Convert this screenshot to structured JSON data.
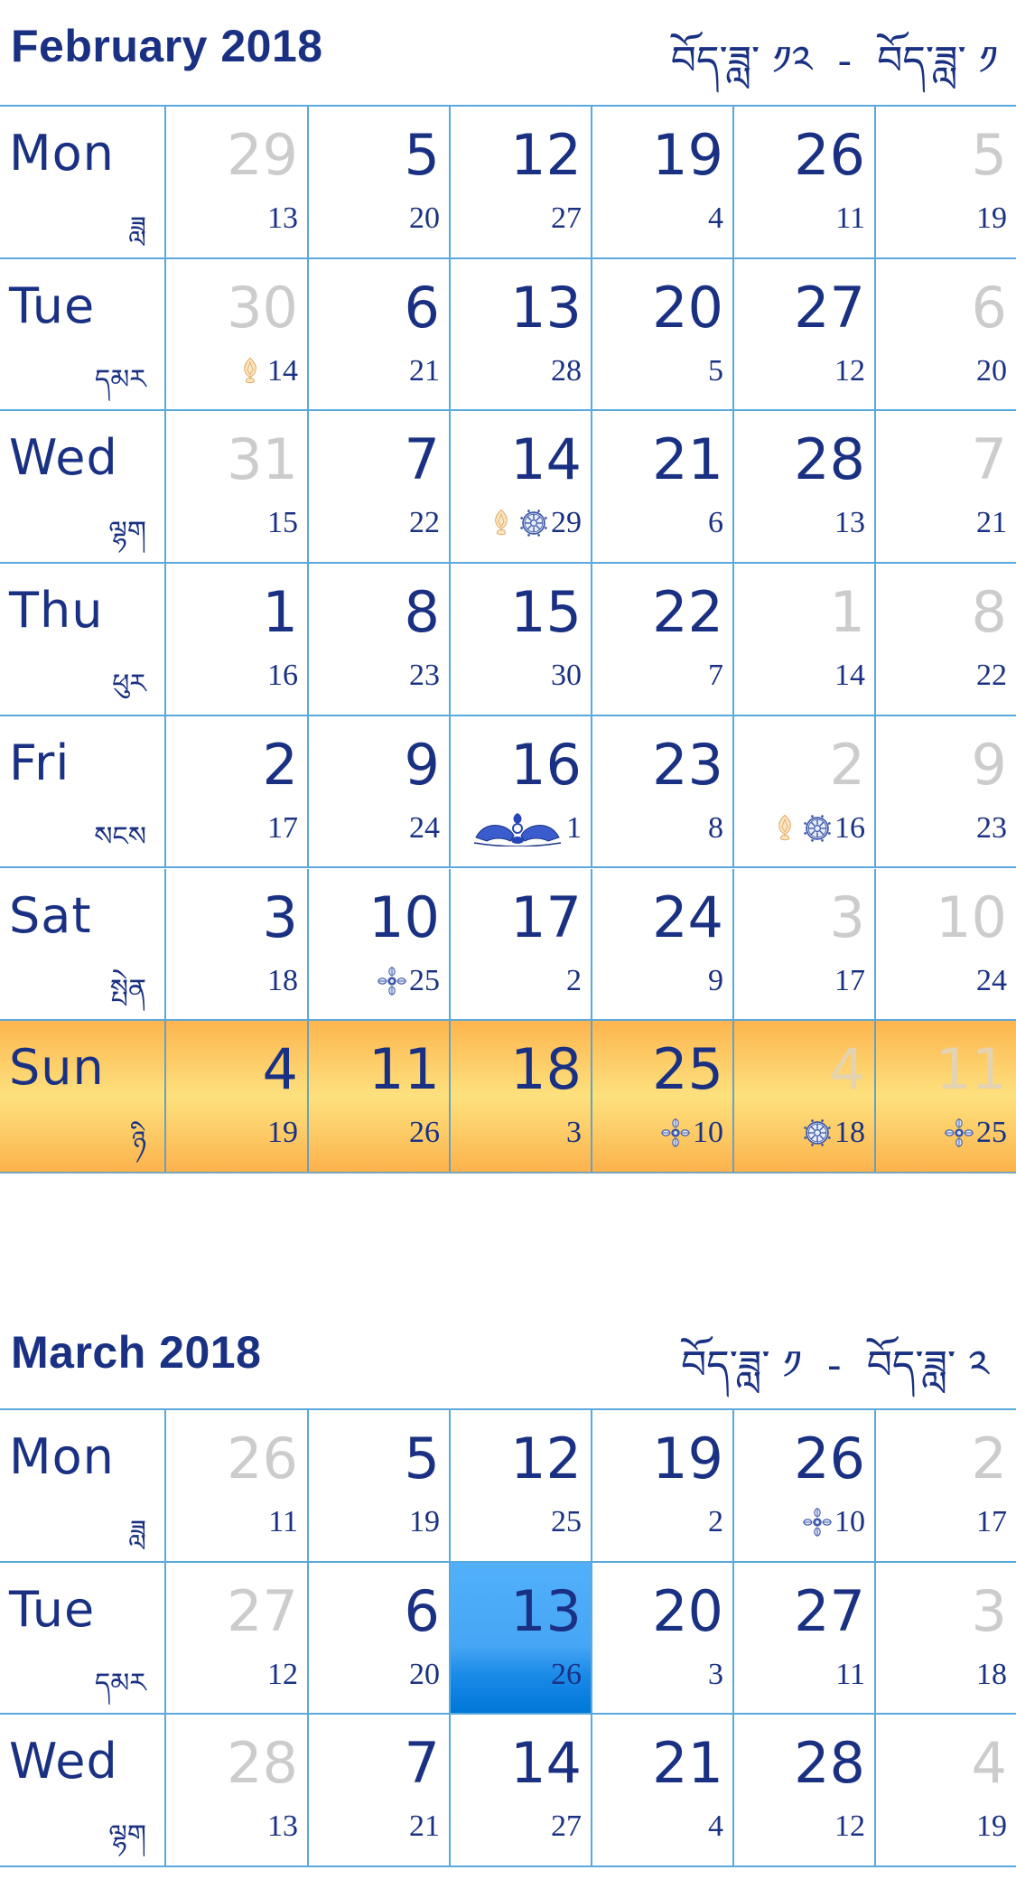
{
  "colors": {
    "primary_text": "#1a3183",
    "other_month_text": "#cccccc",
    "grid_line": "#5aa8dc",
    "sunday_highlight": "#fdd470",
    "today_highlight": "#46a6f5"
  },
  "weekdays": [
    {
      "en": "Mon",
      "tib": "ཟླ"
    },
    {
      "en": "Tue",
      "tib": "དམར"
    },
    {
      "en": "Wed",
      "tib": "ལྷག"
    },
    {
      "en": "Thu",
      "tib": "ཕུར"
    },
    {
      "en": "Fri",
      "tib": "སངས"
    },
    {
      "en": "Sat",
      "tib": "སྤེན"
    },
    {
      "en": "Sun",
      "tib": "ཉི"
    }
  ],
  "months": [
    {
      "title": "February 2018",
      "tibetan_range": "བོད་ཟླ་ ༡༢  -  བོད་ཟླ་ ༡",
      "highlight_row": 6,
      "rows": [
        [
          {
            "day": "29",
            "lunar": "13",
            "other": true
          },
          {
            "day": "5",
            "lunar": "20"
          },
          {
            "day": "12",
            "lunar": "27"
          },
          {
            "day": "19",
            "lunar": "4"
          },
          {
            "day": "26",
            "lunar": "11"
          },
          {
            "day": "5",
            "lunar": "19",
            "other": true
          }
        ],
        [
          {
            "day": "30",
            "lunar": "14",
            "other": true,
            "icons": [
              "flame-jewel"
            ]
          },
          {
            "day": "6",
            "lunar": "21"
          },
          {
            "day": "13",
            "lunar": "28"
          },
          {
            "day": "20",
            "lunar": "5"
          },
          {
            "day": "27",
            "lunar": "12"
          },
          {
            "day": "6",
            "lunar": "20",
            "other": true
          }
        ],
        [
          {
            "day": "31",
            "lunar": "15",
            "other": true
          },
          {
            "day": "7",
            "lunar": "22"
          },
          {
            "day": "14",
            "lunar": "29",
            "icons": [
              "flame-jewel",
              "dharma-wheel"
            ]
          },
          {
            "day": "21",
            "lunar": "6"
          },
          {
            "day": "28",
            "lunar": "13"
          },
          {
            "day": "7",
            "lunar": "21",
            "other": true
          }
        ],
        [
          {
            "day": "1",
            "lunar": "16"
          },
          {
            "day": "8",
            "lunar": "23"
          },
          {
            "day": "15",
            "lunar": "30"
          },
          {
            "day": "22",
            "lunar": "7"
          },
          {
            "day": "1",
            "lunar": "14",
            "other": true
          },
          {
            "day": "8",
            "lunar": "22",
            "other": true
          }
        ],
        [
          {
            "day": "2",
            "lunar": "17"
          },
          {
            "day": "9",
            "lunar": "24"
          },
          {
            "day": "16",
            "lunar": "1",
            "icons": [
              "snow-lions"
            ]
          },
          {
            "day": "23",
            "lunar": "8"
          },
          {
            "day": "2",
            "lunar": "16",
            "other": true,
            "icons": [
              "flame-jewel",
              "dharma-wheel"
            ]
          },
          {
            "day": "9",
            "lunar": "23",
            "other": true
          }
        ],
        [
          {
            "day": "3",
            "lunar": "18"
          },
          {
            "day": "10",
            "lunar": "25",
            "icons": [
              "double-vajra"
            ]
          },
          {
            "day": "17",
            "lunar": "2"
          },
          {
            "day": "24",
            "lunar": "9"
          },
          {
            "day": "3",
            "lunar": "17",
            "other": true
          },
          {
            "day": "10",
            "lunar": "24",
            "other": true
          }
        ],
        [
          {
            "day": "4",
            "lunar": "19"
          },
          {
            "day": "11",
            "lunar": "26"
          },
          {
            "day": "18",
            "lunar": "3"
          },
          {
            "day": "25",
            "lunar": "10",
            "icons": [
              "double-vajra"
            ]
          },
          {
            "day": "4",
            "lunar": "18",
            "other": true,
            "icons": [
              "dharma-wheel"
            ]
          },
          {
            "day": "11",
            "lunar": "25",
            "other": true,
            "icons": [
              "double-vajra"
            ]
          }
        ]
      ]
    },
    {
      "title": "March 2018",
      "tibetan_range": "བོད་ཟླ་ ༡  -  བོད་ཟླ་ ༢",
      "highlight_row": null,
      "rows": [
        [
          {
            "day": "26",
            "lunar": "11",
            "other": true
          },
          {
            "day": "5",
            "lunar": "19"
          },
          {
            "day": "12",
            "lunar": "25"
          },
          {
            "day": "19",
            "lunar": "2"
          },
          {
            "day": "26",
            "lunar": "10",
            "icons": [
              "double-vajra"
            ]
          },
          {
            "day": "2",
            "lunar": "17",
            "other": true
          }
        ],
        [
          {
            "day": "27",
            "lunar": "12",
            "other": true
          },
          {
            "day": "6",
            "lunar": "20"
          },
          {
            "day": "13",
            "lunar": "26",
            "today": true
          },
          {
            "day": "20",
            "lunar": "3"
          },
          {
            "day": "27",
            "lunar": "11"
          },
          {
            "day": "3",
            "lunar": "18",
            "other": true
          }
        ],
        [
          {
            "day": "28",
            "lunar": "13",
            "other": true
          },
          {
            "day": "7",
            "lunar": "21"
          },
          {
            "day": "14",
            "lunar": "27"
          },
          {
            "day": "21",
            "lunar": "4"
          },
          {
            "day": "28",
            "lunar": "12"
          },
          {
            "day": "4",
            "lunar": "19",
            "other": true
          }
        ]
      ]
    }
  ]
}
